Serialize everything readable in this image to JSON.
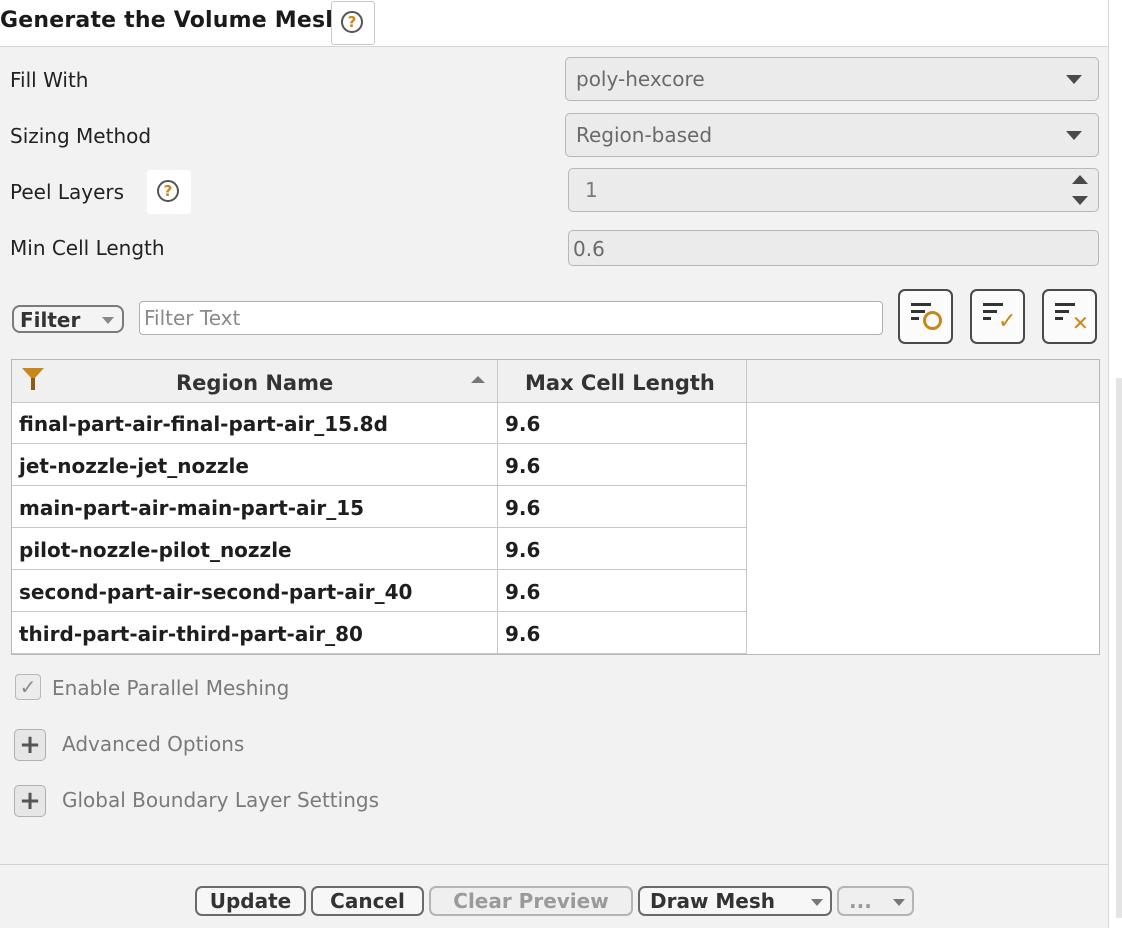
{
  "header": {
    "title": "Generate the Volume Mesh",
    "help_icon": "?"
  },
  "form": {
    "fill_with": {
      "label": "Fill With",
      "value": "poly-hexcore"
    },
    "sizing_method": {
      "label": "Sizing Method",
      "value": "Region-based"
    },
    "peel_layers": {
      "label": "Peel Layers",
      "value": "1",
      "help_icon": "?"
    },
    "min_cell_length": {
      "label": "Min Cell Length",
      "value": "0.6"
    }
  },
  "filter": {
    "button_label": "Filter",
    "placeholder": "Filter Text",
    "tools": [
      "filter-options-icon",
      "filter-select-all-icon",
      "filter-clear-icon"
    ]
  },
  "table": {
    "columns": [
      "Region Name",
      "Max Cell Length"
    ],
    "rows": [
      [
        "final-part-air-final-part-air_15.8d",
        "9.6"
      ],
      [
        "jet-nozzle-jet_nozzle",
        "9.6"
      ],
      [
        "main-part-air-main-part-air_15",
        "9.6"
      ],
      [
        "pilot-nozzle-pilot_nozzle",
        "9.6"
      ],
      [
        "second-part-air-second-part-air_40",
        "9.6"
      ],
      [
        "third-part-air-third-part-air_80",
        "9.6"
      ]
    ]
  },
  "options": {
    "parallel_meshing": {
      "label": "Enable Parallel Meshing",
      "checked": true
    },
    "advanced": {
      "label": "Advanced Options"
    },
    "global_boundary": {
      "label": "Global Boundary Layer Settings"
    }
  },
  "footer": {
    "update": "Update",
    "cancel": "Cancel",
    "clear_preview": "Clear Preview",
    "draw_mesh": "Draw Mesh",
    "more": "..."
  },
  "colors": {
    "accent": "#c8871a",
    "panel_bg": "#f2f2f2",
    "border": "#b8b8b8"
  }
}
